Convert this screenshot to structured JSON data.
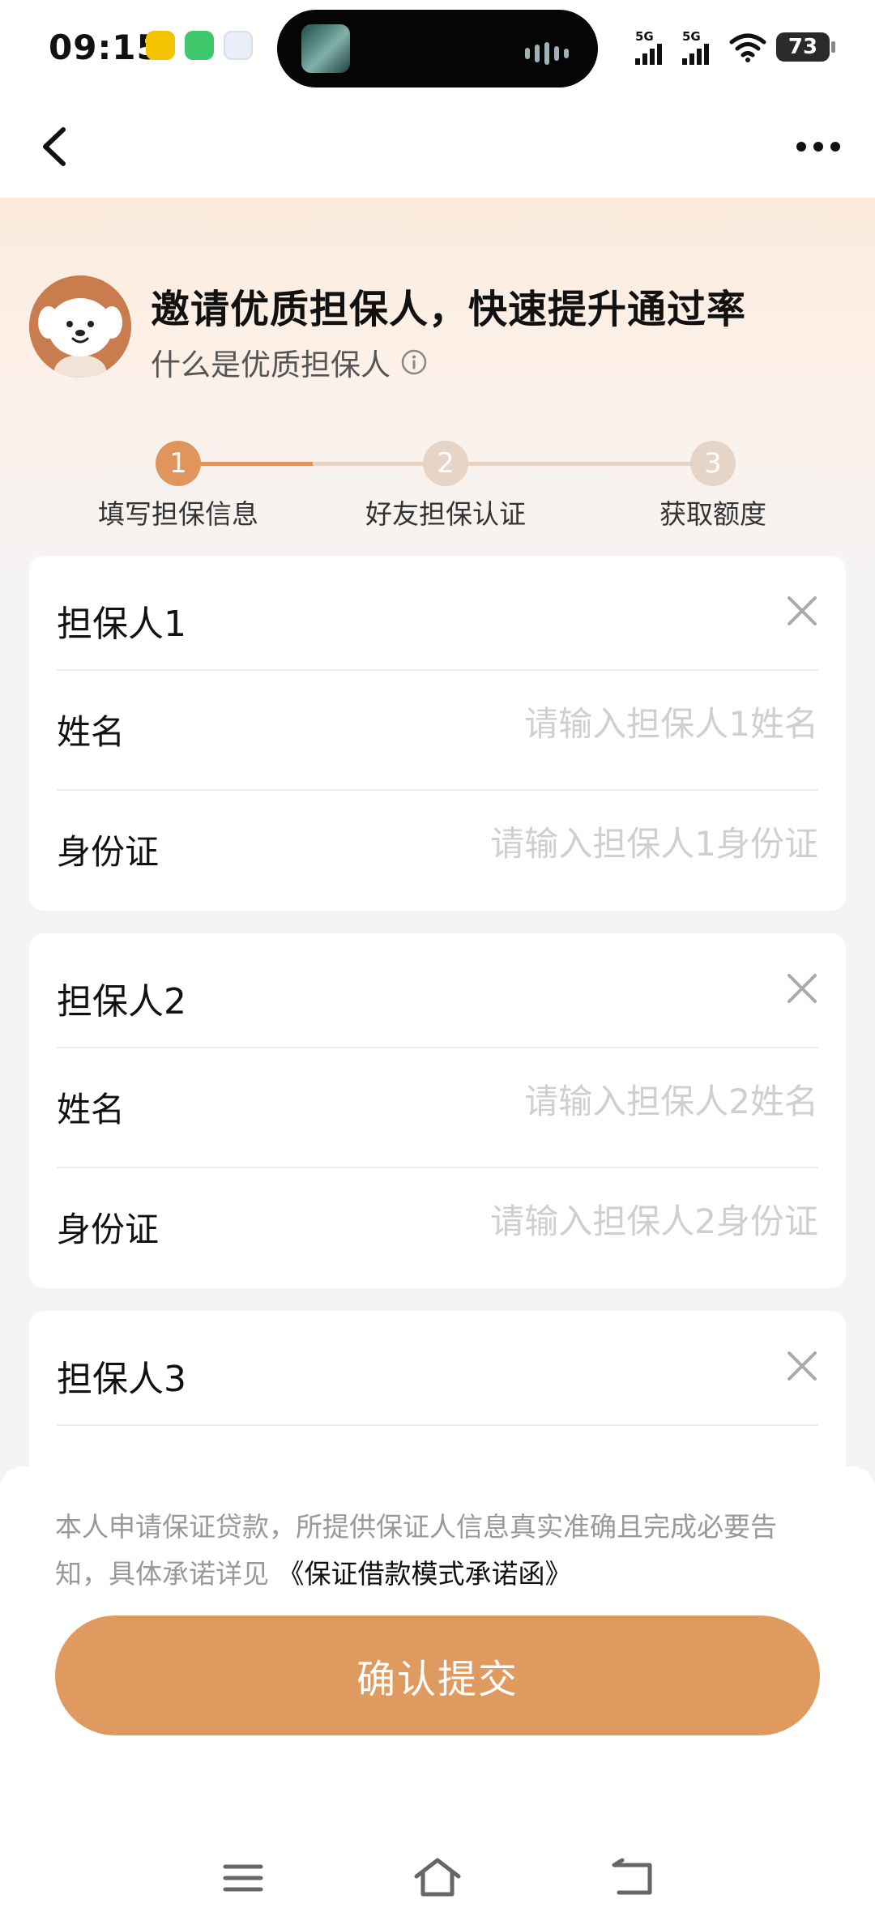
{
  "status_bar": {
    "time": "09:15",
    "network_1": "5G",
    "network_2": "5G",
    "battery": "73"
  },
  "header": {
    "headline": "邀请优质担保人，快速提升通过率",
    "subline": "什么是优质担保人"
  },
  "steps": [
    {
      "num": "1",
      "label": "填写担保信息",
      "active": true
    },
    {
      "num": "2",
      "label": "好友担保认证",
      "active": false
    },
    {
      "num": "3",
      "label": "获取额度",
      "active": false
    }
  ],
  "guarantors": [
    {
      "title": "担保人1",
      "name_label": "姓名",
      "name_placeholder": "请输入担保人1姓名",
      "id_label": "身份证",
      "id_placeholder": "请输入担保人1身份证"
    },
    {
      "title": "担保人2",
      "name_label": "姓名",
      "name_placeholder": "请输入担保人2姓名",
      "id_label": "身份证",
      "id_placeholder": "请输入担保人2身份证"
    },
    {
      "title": "担保人3"
    }
  ],
  "footer": {
    "agreement_text": "本人申请保证贷款，所提供保证人信息真实准确且完成必要告知，具体承诺详见",
    "agreement_link": "《保证借款模式承诺函》",
    "submit_label": "确认提交"
  },
  "colors": {
    "accent": "#df9a5f",
    "step_active": "#e0955c",
    "step_inactive": "#e6d4c6",
    "placeholder": "#cfcfcf"
  }
}
